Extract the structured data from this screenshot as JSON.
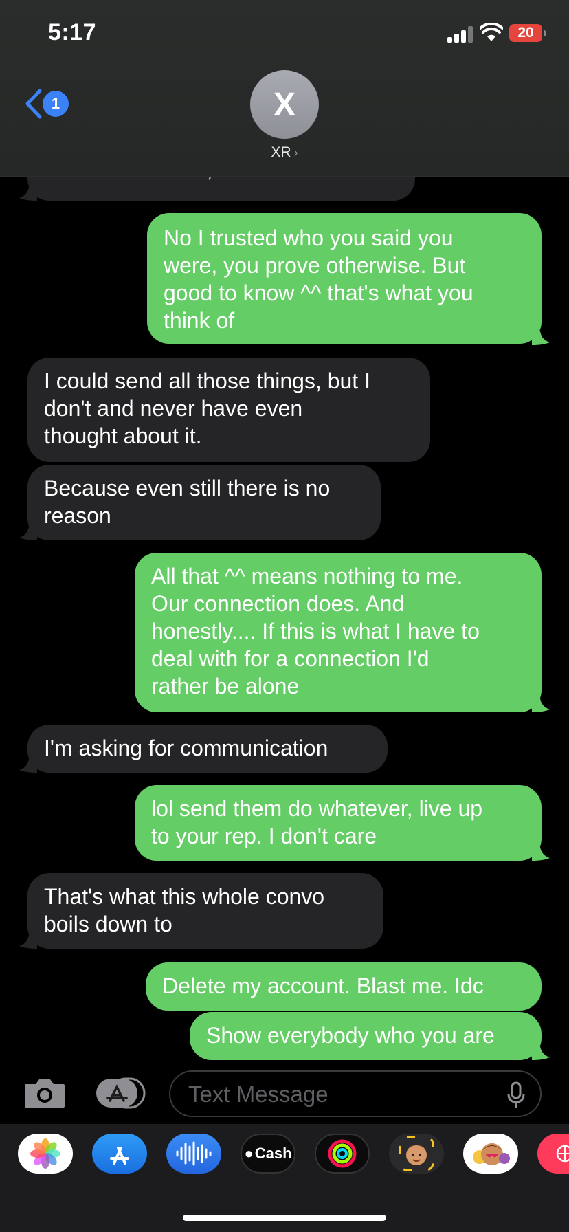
{
  "status_bar": {
    "time": "5:17",
    "battery": "20"
  },
  "header": {
    "back_badge": "1",
    "avatar_initial": "X",
    "contact_name": "XR",
    "contact_chevron": "›"
  },
  "messages": [
    {
      "direction": "incoming",
      "lines": [
        "want to be better, teach me now."
      ]
    },
    {
      "direction": "outgoing",
      "lines": [
        "No I trusted who you said you",
        "were, you prove otherwise. But",
        "good to know ^^ that's what you",
        "think of"
      ]
    },
    {
      "direction": "incoming",
      "lines": [
        "I could send all those things, but I",
        "don't and never have even",
        "thought about it."
      ]
    },
    {
      "direction": "incoming",
      "lines": [
        "Because even still there is no",
        "reason"
      ]
    },
    {
      "direction": "outgoing",
      "lines": [
        "All that ^^ means nothing to me.",
        "Our connection does. And",
        "honestly.... If this is what I have to",
        "deal with for a connection I'd",
        "rather be alone"
      ]
    },
    {
      "direction": "incoming",
      "lines": [
        "I'm asking for communication"
      ]
    },
    {
      "direction": "outgoing",
      "lines": [
        "lol send them do whatever, live up",
        "to your rep. I don't care"
      ]
    },
    {
      "direction": "incoming",
      "lines": [
        "That's what this whole convo",
        "boils down to"
      ]
    },
    {
      "direction": "outgoing",
      "lines": [
        "Delete my account. Blast me. Idc"
      ]
    },
    {
      "direction": "outgoing",
      "lines": [
        "Show everybody who you are"
      ]
    }
  ],
  "composer": {
    "placeholder": "Text Message"
  },
  "app_drawer": {
    "apps": [
      "photos-icon",
      "app-store-icon",
      "audio-message-icon",
      "apple-cash-icon",
      "activity-icon",
      "memoji-icon",
      "animoji-icon",
      "more-apps-icon"
    ],
    "cash_label": "Cash"
  },
  "colors": {
    "outgoing": "#65cd66",
    "incoming": "#252527",
    "accent": "#3a82f6"
  }
}
